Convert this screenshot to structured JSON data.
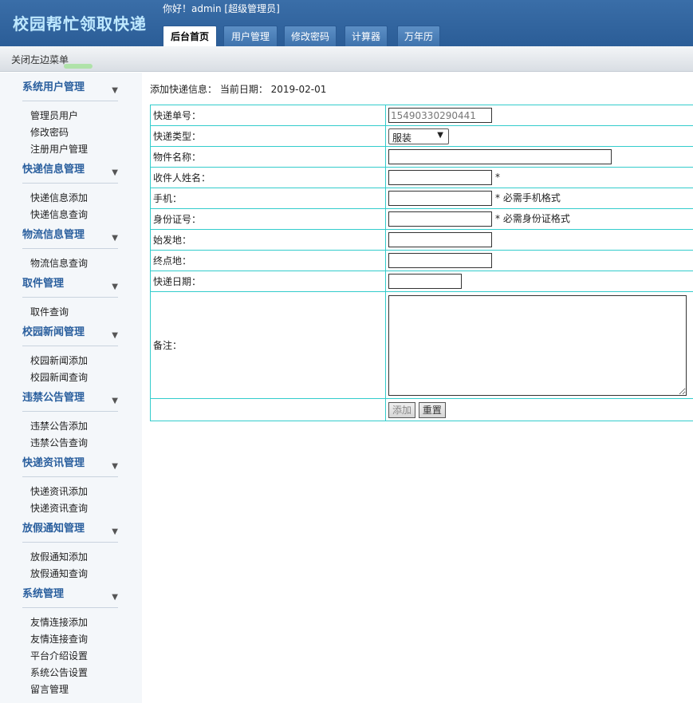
{
  "header": {
    "app_title": "校园帮忙领取快递",
    "greeting": "你好！admin [超级管理员]",
    "tabs": [
      "后台首页",
      "用户管理",
      "修改密码",
      "计算器",
      "万年历"
    ]
  },
  "subbar": {
    "close_menu": "关闭左边菜单"
  },
  "sidebar": {
    "groups": [
      {
        "title": "系统用户管理",
        "items": [
          "管理员用户",
          "修改密码",
          "注册用户管理"
        ]
      },
      {
        "title": "快递信息管理",
        "items": [
          "快递信息添加",
          "快递信息查询"
        ]
      },
      {
        "title": "物流信息管理",
        "items": [
          "物流信息查询"
        ]
      },
      {
        "title": "取件管理",
        "items": [
          "取件查询"
        ]
      },
      {
        "title": "校园新闻管理",
        "items": [
          "校园新闻添加",
          "校园新闻查询"
        ]
      },
      {
        "title": "违禁公告管理",
        "items": [
          "违禁公告添加",
          "违禁公告查询"
        ]
      },
      {
        "title": "快递资讯管理",
        "items": [
          "快递资讯添加",
          "快递资讯查询"
        ]
      },
      {
        "title": "放假通知管理",
        "items": [
          "放假通知添加",
          "放假通知查询"
        ]
      },
      {
        "title": "系统管理",
        "items": [
          "友情连接添加",
          "友情连接查询",
          "平台介绍设置",
          "系统公告设置",
          "留言管理"
        ]
      }
    ],
    "arrow_icon": "triangle-down-icon"
  },
  "main": {
    "crumb": "添加快递信息： 当前日期： 2019-02-01",
    "form": {
      "tracking_label": "快递单号：",
      "tracking_value": "15490330290441",
      "type_label": "快递类型：",
      "type_value": "服装",
      "item_label": "物件名称：",
      "recipient_label": "收件人姓名：",
      "recipient_hint": "*",
      "phone_label": "手机：",
      "phone_hint": "* 必需手机格式",
      "idcard_label": "身份证号：",
      "idcard_hint": "* 必需身份证格式",
      "origin_label": "始发地：",
      "dest_label": "终点地：",
      "date_label": "快递日期：",
      "remark_label": "备注：",
      "add_button": "添加",
      "reset_button": "重置"
    }
  }
}
